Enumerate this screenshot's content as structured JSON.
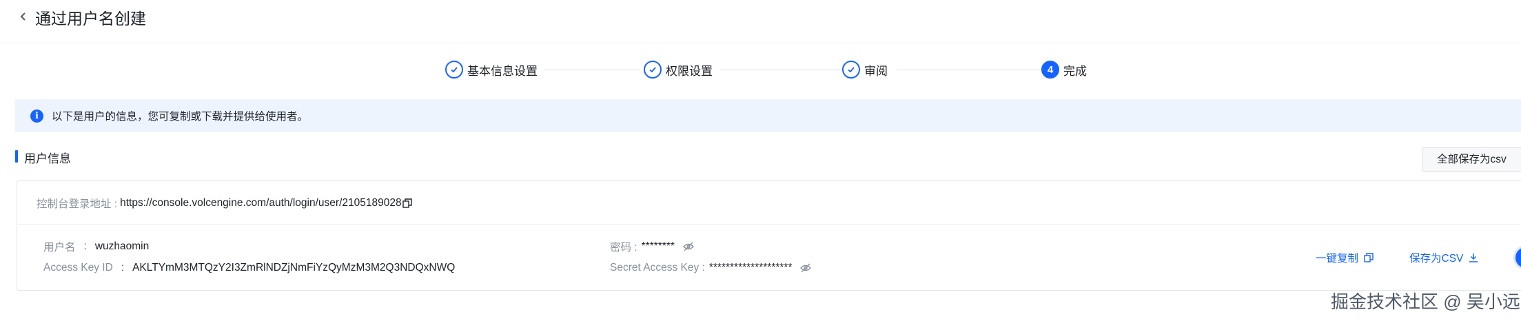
{
  "header": {
    "back_icon": "chevron-left-icon",
    "title": "通过用户名创建"
  },
  "steps": [
    {
      "label": "基本信息设置",
      "status": "done",
      "icon": "check-icon"
    },
    {
      "label": "权限设置",
      "status": "done",
      "icon": "check-icon"
    },
    {
      "label": "审阅",
      "status": "done",
      "icon": "check-icon"
    },
    {
      "label": "完成",
      "status": "active",
      "number": "4"
    }
  ],
  "alert": {
    "icon": "info-icon",
    "text": "以下是用户的信息，您可复制或下载并提供给使用者。"
  },
  "section": {
    "title": "用户信息"
  },
  "actions": {
    "save_all_csv": "全部保存为csv"
  },
  "card": {
    "console_label": "控制台登录地址 :",
    "console_url": "https://console.volcengine.com/auth/login/user/2105189028",
    "username_label": "用户名",
    "separator": ":",
    "username_value": "wuzhaomin",
    "access_key_label": "Access Key ID",
    "access_key_value": "AKLTYmM3MTQzY2I3ZmRlNDZjNmFiYzQyMzM3M2Q3NDQxNWQ",
    "password_label": "密码 :",
    "password_value": "********",
    "secret_label": "Secret Access Key :",
    "secret_value": "********************",
    "copy_all": "一键复制",
    "save_csv": "保存为CSV"
  },
  "colors": {
    "accent": "#1664ff",
    "alert_bg": "#eef4fe",
    "border": "#e5e6eb"
  },
  "watermark": "掘金技术社区 @ 吴小远"
}
